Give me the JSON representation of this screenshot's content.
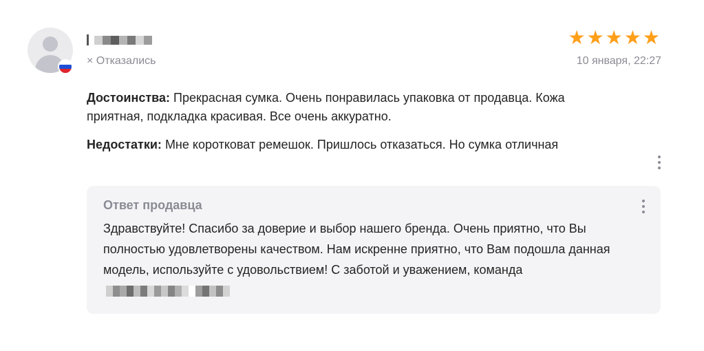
{
  "reviewer": {
    "status": "Отказались"
  },
  "rating": {
    "stars": 5,
    "max": 5,
    "color": "#ff9f1a"
  },
  "date": "10 января, 22:27",
  "review": {
    "pros_label": "Достоинства:",
    "pros_text": "Прекрасная сумка. Очень понравилась упаковка от продавца. Кожа приятная, подкладка красивая. Все очень аккуратно.",
    "cons_label": "Недостатки:",
    "cons_text": "Мне коротковат ремешок. Пришлось отказаться. Но сумка отличная"
  },
  "seller_reply": {
    "title": "Ответ продавца",
    "text": "Здравствуйте! Спасибо за доверие и выбор нашего бренда. Очень приятно, что Вы полностью удовлетворены качеством. Нам искренне приятно, что Вам подошла данная модель, используйте с удовольствием! С заботой и уважением, команда"
  }
}
